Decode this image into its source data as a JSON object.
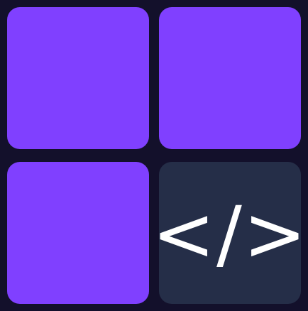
{
  "tiles": {
    "top_left": {
      "color": "#8040ff"
    },
    "top_right": {
      "color": "#8040ff"
    },
    "bottom_left": {
      "color": "#8040ff"
    },
    "bottom_right": {
      "color": "#252e48",
      "icon": "code-brackets-icon",
      "glyph": "</>"
    }
  },
  "background_color": "#13102b"
}
